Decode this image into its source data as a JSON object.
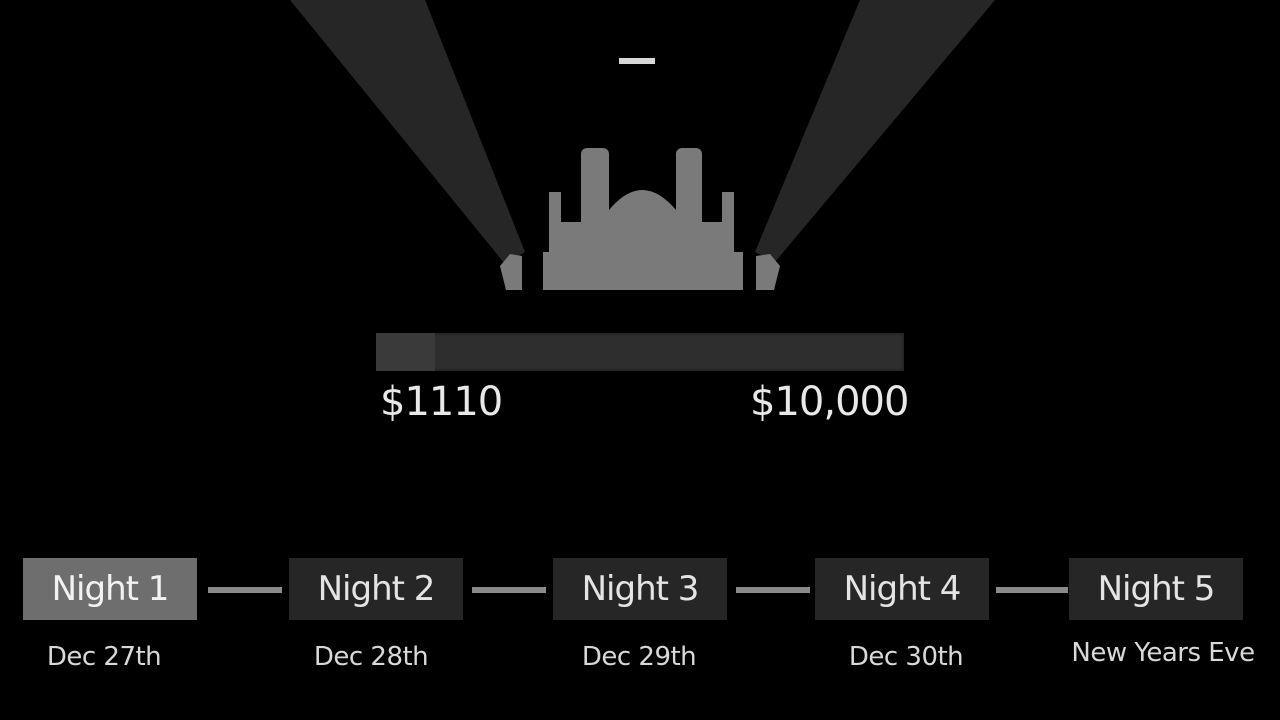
{
  "progress": {
    "current_label": "$1110",
    "goal_label": "$10,000",
    "fraction": 0.111
  },
  "nights": [
    {
      "label": "Night 1",
      "date": "Dec 27th",
      "selected": true
    },
    {
      "label": "Night 2",
      "date": "Dec 28th",
      "selected": false
    },
    {
      "label": "Night 3",
      "date": "Dec 29th",
      "selected": false
    },
    {
      "label": "Night 4",
      "date": "Dec 30th",
      "selected": false
    },
    {
      "label": "Night 5",
      "date": "New Years Eve",
      "selected": false
    }
  ],
  "colors": {
    "background": "#000000",
    "spotlight": "#262626",
    "building": "#7a7a7a",
    "button": "#262626",
    "button_selected": "#6e6e6e"
  }
}
